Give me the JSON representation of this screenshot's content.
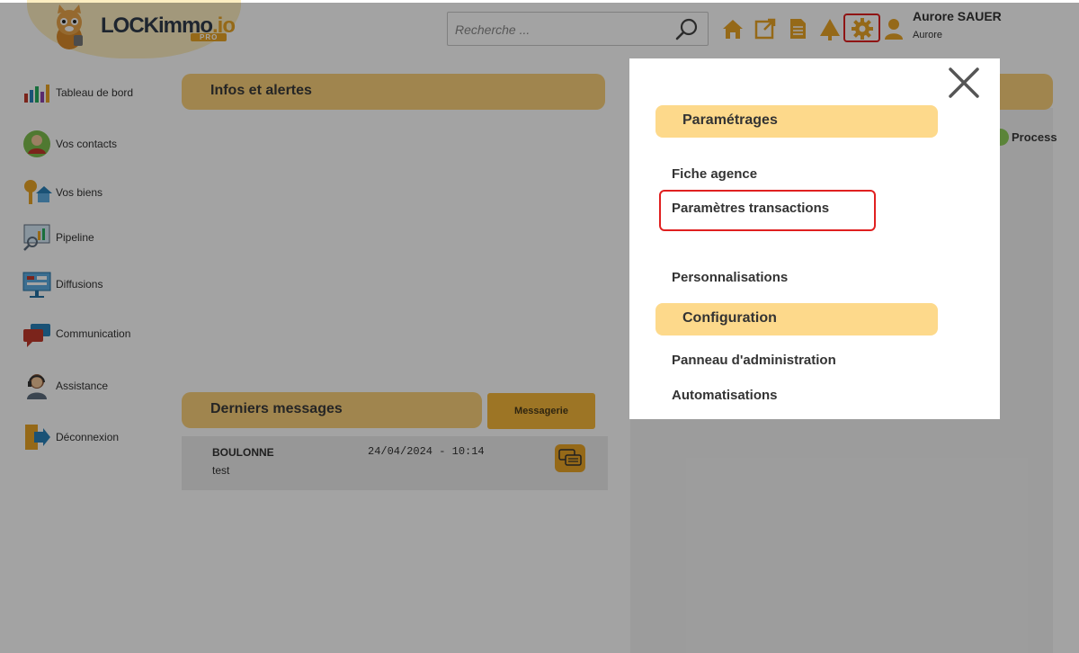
{
  "app": {
    "logo_name": "LOCKimmo",
    "logo_suffix": ".io",
    "logo_badge": "PRO"
  },
  "search": {
    "placeholder": "Recherche ..."
  },
  "toolbar_icons": [
    "home-icon",
    "external-link-icon",
    "document-icon",
    "tree-icon",
    "gear-icon",
    "user-icon"
  ],
  "user": {
    "name": "Aurore SAUER",
    "first_name": "Aurore"
  },
  "sidebar": {
    "items": [
      {
        "label": "Tableau de bord",
        "icon": "dashboard-icon"
      },
      {
        "label": "Vos contacts",
        "icon": "contacts-icon"
      },
      {
        "label": "Vos biens",
        "icon": "properties-icon"
      },
      {
        "label": "Pipeline",
        "icon": "pipeline-icon"
      },
      {
        "label": "Diffusions",
        "icon": "diffusion-icon"
      },
      {
        "label": "Communication",
        "icon": "communication-icon"
      },
      {
        "label": "Assistance",
        "icon": "assistance-icon"
      },
      {
        "label": "Déconnexion",
        "icon": "logout-icon"
      }
    ]
  },
  "main": {
    "infos_title": "Infos et alertes",
    "messages_title": "Derniers messages",
    "messagerie_button": "Messagerie",
    "messages": [
      {
        "sender": "BOULONNE",
        "date": "24/04/2024 - 10:14",
        "text": "test"
      }
    ],
    "process_button": "Process"
  },
  "modal": {
    "sections": [
      {
        "title": "Paramétrages",
        "links": [
          "Fiche agence",
          "Paramètres transactions",
          "Personnalisations"
        ]
      },
      {
        "title": "Configuration",
        "links": [
          "Panneau d'administration",
          "Automatisations"
        ]
      }
    ]
  },
  "colors": {
    "accent": "#f6b83b",
    "section_bar": "#fad17a",
    "modal_header": "#fdd98b",
    "highlight": "#e02020",
    "icon_orange": "#e9a426"
  }
}
